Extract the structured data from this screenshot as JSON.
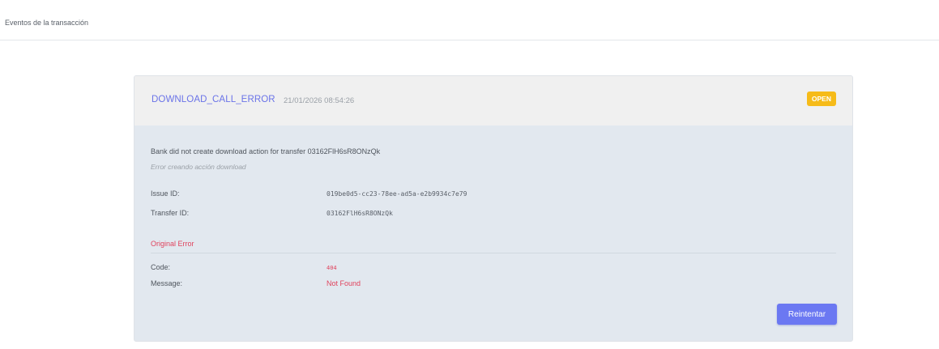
{
  "page": {
    "title": "Eventos de la transacción"
  },
  "event": {
    "name": "DOWNLOAD_CALL_ERROR",
    "timestamp": "21/01/2026 08:54:26",
    "status": "OPEN",
    "message": "Bank did not create download action for transfer 03162FlH6sR8ONzQk",
    "sub_message": "Error creando acción download",
    "issue_id_label": "Issue ID:",
    "issue_id": "019be0d5-cc23-78ee-ad5a-e2b9934c7e79",
    "transfer_id_label": "Transfer ID:",
    "transfer_id": "03162FlH6sR8ONzQk"
  },
  "original_error": {
    "title": "Original Error",
    "code_label": "Code:",
    "code": "404",
    "message_label": "Message:",
    "message": "Not Found"
  },
  "actions": {
    "retry_label": "Reintentar"
  },
  "colors": {
    "accent": "#6b78f2",
    "status_open": "#f6bb19",
    "error": "#e0435d"
  }
}
